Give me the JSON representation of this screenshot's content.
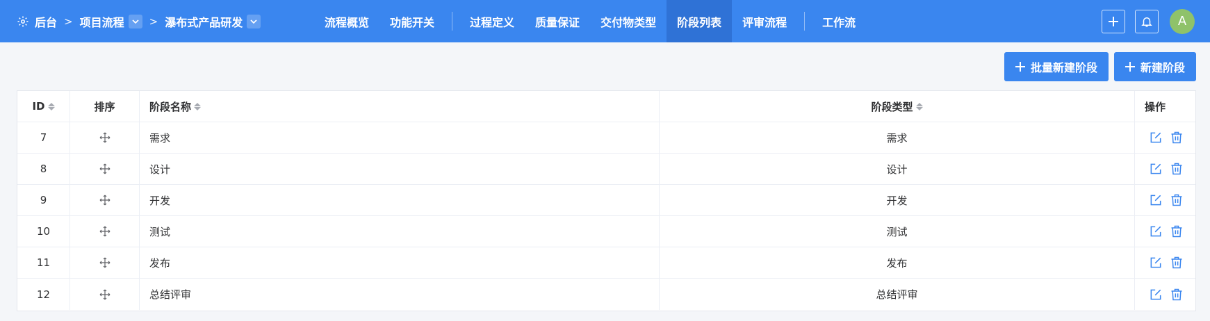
{
  "breadcrumb": {
    "root": "后台",
    "project": "项目流程",
    "process": "瀑布式产品研发"
  },
  "nav": {
    "items": [
      "流程概览",
      "功能开关",
      "过程定义",
      "质量保证",
      "交付物类型",
      "阶段列表",
      "评审流程",
      "工作流"
    ],
    "active": "阶段列表"
  },
  "user": {
    "avatar_initial": "A"
  },
  "toolbar": {
    "batch_new_label": "批量新建阶段",
    "new_label": "新建阶段"
  },
  "table": {
    "headers": {
      "id": "ID",
      "order": "排序",
      "name": "阶段名称",
      "type": "阶段类型",
      "ops": "操作"
    },
    "rows": [
      {
        "id": "7",
        "name": "需求",
        "type": "需求"
      },
      {
        "id": "8",
        "name": "设计",
        "type": "设计"
      },
      {
        "id": "9",
        "name": "开发",
        "type": "开发"
      },
      {
        "id": "10",
        "name": "测试",
        "type": "测试"
      },
      {
        "id": "11",
        "name": "发布",
        "type": "发布"
      },
      {
        "id": "12",
        "name": "总结评审",
        "type": "总结评审"
      }
    ]
  },
  "colors": {
    "primary": "#3a86ef",
    "active_nav": "#2f72d6",
    "avatar": "#8fc26a"
  }
}
